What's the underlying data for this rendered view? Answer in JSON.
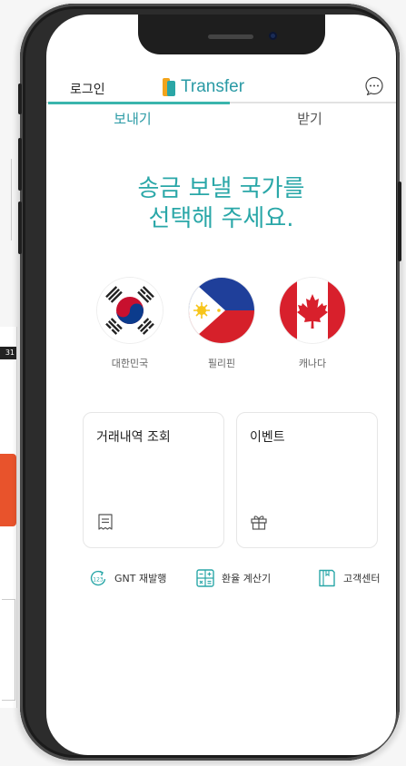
{
  "background": {
    "window_badge": "31"
  },
  "header": {
    "login": "로그인",
    "logo_text": "Transfer"
  },
  "tabs": [
    {
      "label": "보내기"
    },
    {
      "label": "받기"
    }
  ],
  "headline": {
    "line1": "송금 보낼 국가를",
    "line2": "선택해 주세요."
  },
  "countries": [
    {
      "name": "대한민국",
      "flag": "korea-flag"
    },
    {
      "name": "필리핀",
      "flag": "philippines-flag"
    },
    {
      "name": "캐나다",
      "flag": "canada-flag"
    }
  ],
  "cards": [
    {
      "title": "거래내역 조회",
      "icon": "receipt-icon"
    },
    {
      "title": "이벤트",
      "icon": "gift-icon"
    }
  ],
  "links": [
    {
      "label": "GNT 재발행",
      "icon": "reissue-icon"
    },
    {
      "label": "환율 계산기",
      "icon": "calculator-icon"
    },
    {
      "label": "고객센터",
      "icon": "book-icon"
    }
  ],
  "colors": {
    "accent": "#2aa7a8",
    "logo_orange": "#f2a41c",
    "frame": "#2c2c2c"
  }
}
